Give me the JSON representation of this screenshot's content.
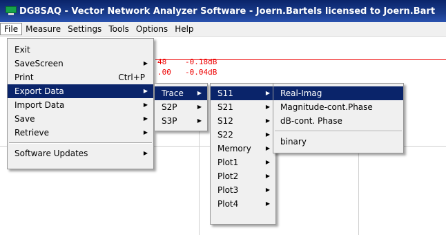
{
  "window": {
    "title": "DG8SAQ  -  Vector Network Analyzer Software  - Joern.Bartels licensed to Joern.Bart"
  },
  "menubar": [
    "File",
    "Measure",
    "Settings",
    "Tools",
    "Options",
    "Help"
  ],
  "readouts": [
    "48",
    "-0.18dB",
    ".00",
    "-0.04dB"
  ],
  "file_menu": {
    "items": [
      {
        "label": "Exit"
      },
      {
        "label": "SaveScreen",
        "arrow": "▶"
      },
      {
        "label": "Print",
        "shortcut": "Ctrl+P"
      },
      {
        "label": "Export Data",
        "arrow": "▶"
      },
      {
        "label": "Import Data",
        "arrow": "▶"
      },
      {
        "label": "Save",
        "arrow": "▶"
      },
      {
        "label": "Retrieve",
        "arrow": "▶"
      },
      {
        "label": "Software Updates",
        "arrow": "▶"
      }
    ]
  },
  "export_menu": {
    "items": [
      {
        "label": "Trace",
        "arrow": "▶"
      },
      {
        "label": "S2P",
        "arrow": "▶"
      },
      {
        "label": "S3P",
        "arrow": "▶"
      }
    ]
  },
  "trace_menu": {
    "items": [
      {
        "label": "S11",
        "arrow": "▶"
      },
      {
        "label": "S21",
        "arrow": "▶"
      },
      {
        "label": "S12",
        "arrow": "▶"
      },
      {
        "label": "S22",
        "arrow": "▶"
      },
      {
        "label": "Memory",
        "arrow": "▶"
      },
      {
        "label": "Plot1",
        "arrow": "▶"
      },
      {
        "label": "Plot2",
        "arrow": "▶"
      },
      {
        "label": "Plot3",
        "arrow": "▶"
      },
      {
        "label": "Plot4",
        "arrow": "▶"
      }
    ]
  },
  "s11_menu": {
    "items": [
      {
        "label": "Real-Imag"
      },
      {
        "label": "Magnitude-cont.Phase"
      },
      {
        "label": "dB-cont. Phase"
      },
      {
        "label": "binary"
      }
    ]
  },
  "colors": {
    "highlight": "#0a246a",
    "trace": "#ee0000"
  }
}
